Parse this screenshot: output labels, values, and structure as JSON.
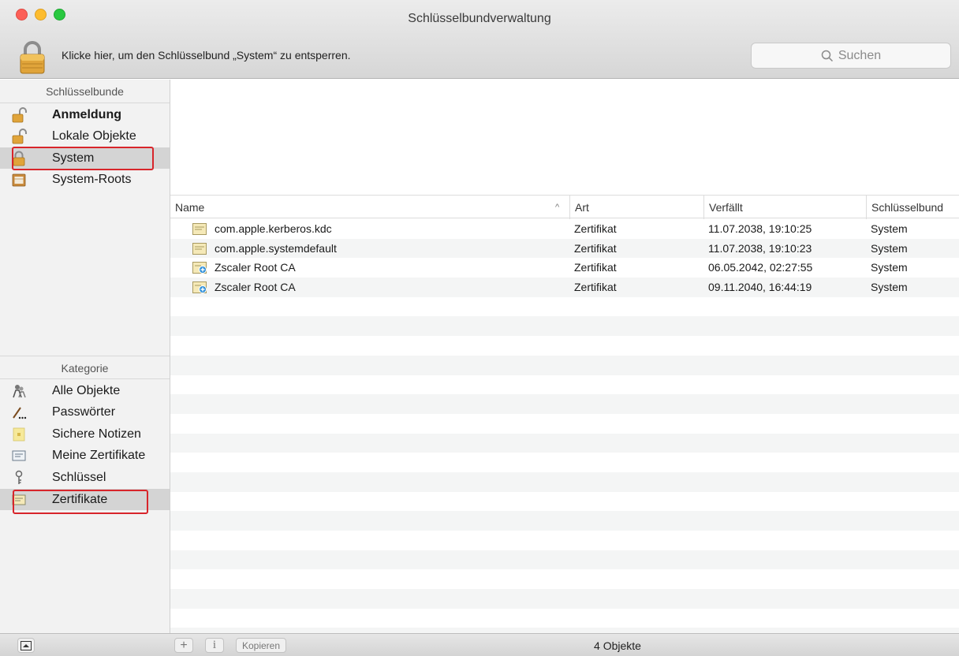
{
  "window": {
    "title": "Schlüsselbundverwaltung",
    "unlock_text": "Klicke hier, um den Schlüsselbund „System“ zu entsperren.",
    "search_placeholder": "Suchen"
  },
  "sidebar": {
    "keychains_header": "Schlüsselbunde",
    "keychains": [
      {
        "label": "Anmeldung",
        "icon": "unlocked-padlock-icon",
        "bold": true
      },
      {
        "label": "Lokale Objekte",
        "icon": "unlocked-padlock-icon"
      },
      {
        "label": "System",
        "icon": "locked-padlock-icon",
        "selected": true
      },
      {
        "label": "System-Roots",
        "icon": "cabinet-icon"
      }
    ],
    "category_header": "Kategorie",
    "categories": [
      {
        "label": "Alle Objekte",
        "icon": "people-icon"
      },
      {
        "label": "Passwörter",
        "icon": "pen-icon"
      },
      {
        "label": "Sichere Notizen",
        "icon": "note-icon"
      },
      {
        "label": "Meine Zertifikate",
        "icon": "certificate-icon"
      },
      {
        "label": "Schlüssel",
        "icon": "key-icon"
      },
      {
        "label": "Zertifikate",
        "icon": "certificate-icon",
        "selected": true
      }
    ]
  },
  "table": {
    "columns": [
      "Name",
      "Art",
      "Verfällt",
      "Schlüsselbund"
    ],
    "rows": [
      {
        "name": "com.apple.kerberos.kdc",
        "art": "Zertifikat",
        "expires": "11.07.2038, 19:10:25",
        "keychain": "System",
        "icon": "certificate-icon"
      },
      {
        "name": "com.apple.systemdefault",
        "art": "Zertifikat",
        "expires": "11.07.2038, 19:10:23",
        "keychain": "System",
        "icon": "certificate-icon"
      },
      {
        "name": "Zscaler Root CA",
        "art": "Zertifikat",
        "expires": "06.05.2042, 02:27:55",
        "keychain": "System",
        "icon": "root-certificate-icon"
      },
      {
        "name": "Zscaler Root CA",
        "art": "Zertifikat",
        "expires": "09.11.2040, 16:44:19",
        "keychain": "System",
        "icon": "root-certificate-icon"
      }
    ]
  },
  "bottom": {
    "add_label": "+",
    "info_label": "i",
    "copy_label": "Kopieren",
    "status": "4 Objekte"
  },
  "colors": {
    "highlight": "#d8252b",
    "selected_row": "#d4d4d4"
  }
}
